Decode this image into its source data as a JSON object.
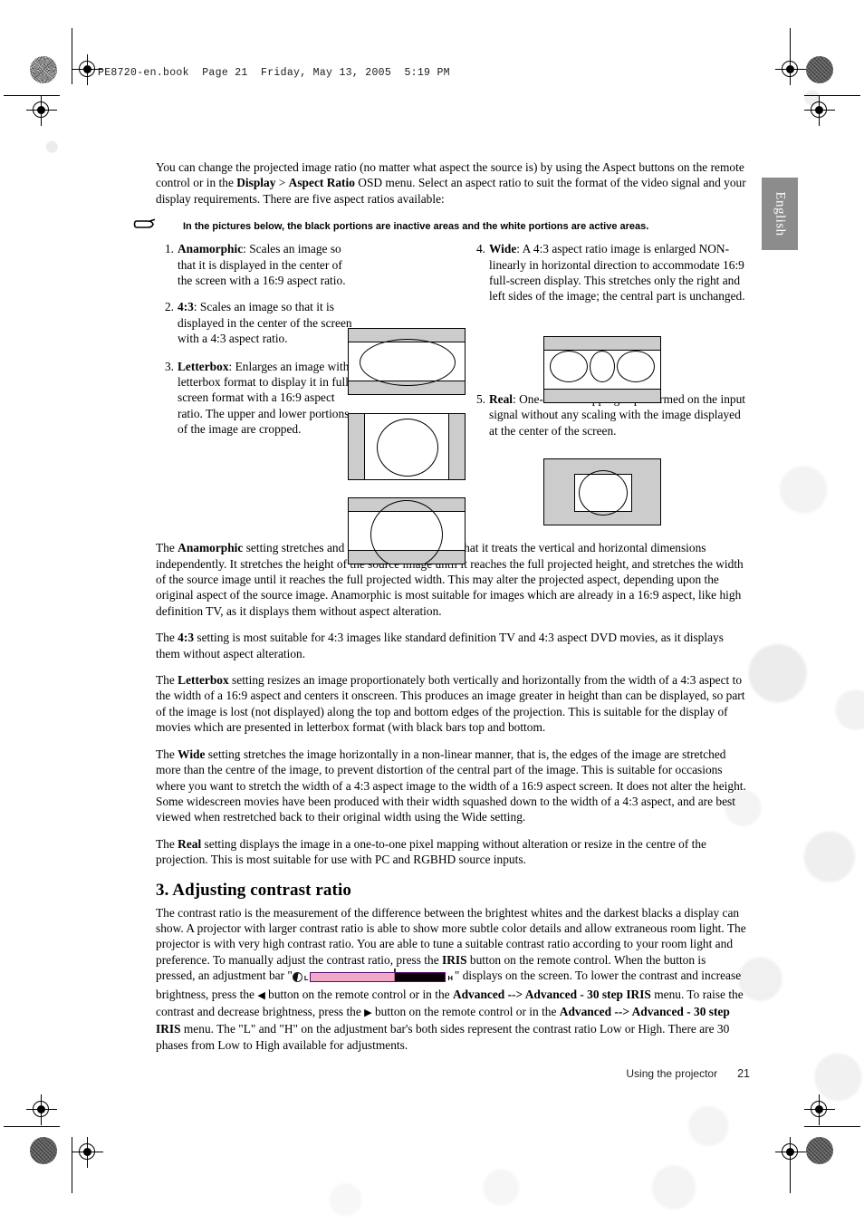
{
  "header": {
    "book_line": "PE8720-en.book  Page 21  Friday, May 13, 2005  5:19 PM"
  },
  "side_tab": {
    "label": "English"
  },
  "intro": {
    "p1_a": "You can change the projected image ratio (no matter what aspect the source is) by using the Aspect buttons on the remote control or in the ",
    "p1_b1": "Display",
    "p1_mid": " > ",
    "p1_b2": "Aspect Ratio",
    "p1_c": " OSD menu. Select an aspect ratio to suit the format of the video signal and your display requirements. There are five aspect ratios available:"
  },
  "note": {
    "icon": "pointing-hand-icon",
    "text": "In the pictures below, the black portions are inactive areas and the white portions are active areas."
  },
  "aspect_items": [
    {
      "num": "1.",
      "term": "Anamorphic",
      "desc": ": Scales an image so that it is displayed in the center of the screen with a 16:9 aspect ratio."
    },
    {
      "num": "2.",
      "term": "4:3",
      "desc": ": Scales an image so that it is displayed in the center of the screen with a 4:3 aspect ratio."
    },
    {
      "num": "3.",
      "term": "Letterbox",
      "desc": ": Enlarges an image with letterbox format to display it in full-screen format with a 16:9 aspect ratio. The upper and lower portions of the image are cropped."
    },
    {
      "num": "4.",
      "term": "Wide",
      "desc": ": A 4:3 aspect ratio image is enlarged NON-linearly in horizontal direction to accommodate 16:9 full-screen display. This stretches only the right and left sides of the image; the central part is unchanged."
    },
    {
      "num": "5.",
      "term": "Real",
      "desc": ": One-to-one mapping is performed on the input signal without any scaling with the image displayed at the center of the screen."
    }
  ],
  "diagrams": {
    "anamorphic": "anamorphic-aspect-diagram",
    "four_three": "4-3-aspect-diagram",
    "letterbox": "letterbox-aspect-diagram",
    "wide": "wide-aspect-diagram",
    "real": "real-aspect-diagram",
    "inactive_color": "#cccccc",
    "active_color": "#ffffff"
  },
  "paragraphs": {
    "anamorphic": {
      "pre": "The ",
      "term": "Anamorphic",
      "post": " setting stretches and resizes linearly, except that it treats the vertical and horizontal dimensions independently. It stretches the height of the source image until it reaches the full projected height, and stretches the width of the source image until it reaches the full projected width. This may alter the projected aspect, depending upon the original aspect of the source image. Anamorphic is most suitable for images which are already in a 16:9 aspect, like high definition TV, as it displays them without aspect alteration."
    },
    "four_three": {
      "pre": "The ",
      "term": "4:3",
      "post": " setting is most suitable for 4:3 images like standard definition TV and 4:3 aspect DVD movies, as it displays them without aspect alteration."
    },
    "letterbox": {
      "pre": "The ",
      "term": "Letterbox",
      "post": " setting resizes an image proportionately both vertically and horizontally from the width of a 4:3 aspect to the width of a 16:9 aspect and centers it onscreen. This produces an image greater in height than can be displayed, so part of the image is lost (not displayed) along the top and bottom edges of the projection. This is suitable for the display of movies which are presented in letterbox format (with black bars top and bottom."
    },
    "wide": {
      "pre": "The ",
      "term": "Wide",
      "post": " setting stretches the image horizontally in a non-linear manner, that is, the edges of the image are stretched more than the centre of the image, to prevent distortion of the central part of the image. This is suitable for occasions where you want to stretch the width of a 4:3 aspect image to the width of a 16:9 aspect screen. It does not alter the height. Some widescreen movies have been produced with their width squashed down to the width of a 4:3 aspect, and are best viewed when restretched back to their original width using the Wide setting."
    },
    "real": {
      "pre": "The ",
      "term": "Real",
      "post": " setting displays the image in a one-to-one pixel mapping without alteration or resize in the centre of the projection. This is most suitable for use with PC and RGBHD source inputs."
    }
  },
  "section3": {
    "heading": "3. Adjusting contrast ratio",
    "t1": "The contrast ratio is the measurement of the difference between the brightest whites and the darkest blacks a display can show. A projector with larger contrast ratio is able to show more subtle color details and allow extraneous room light. The projector is with very high contrast ratio. You are able to tune a suitable contrast ratio according to your room light and preference. To manually adjust the contrast ratio, press the ",
    "iris_bold_1": "IRIS",
    "t2": " button on the remote control. When the button is pressed, an adjustment bar \"",
    "bar_low_label": "L",
    "bar_high_label": "H",
    "t3": "\" displays on the screen. To lower the contrast and increase brightness, press the ",
    "tri_left": "◀",
    "t4": " button on the remote control or in the ",
    "menu_path_1": "Advanced --> Advanced - 30 step IRIS",
    "t5": " menu. To raise the contrast and decrease brightness, press the ",
    "tri_right": "▶",
    "t6": " button on the remote control or in the ",
    "menu_path_2": "Advanced --> Advanced - 30 step IRIS",
    "t7": " menu. The \"L\" and \"H\" on the adjustment bar's both sides represent the contrast ratio Low or High. There are 30 phases from Low to High available for adjustments.",
    "bar_fill_color": "#f0a8c8",
    "bar_border_color": "#5c0b6e",
    "bar_empty_color": "#0a0008"
  },
  "footer": {
    "label": "Using the projector",
    "page": "21"
  }
}
